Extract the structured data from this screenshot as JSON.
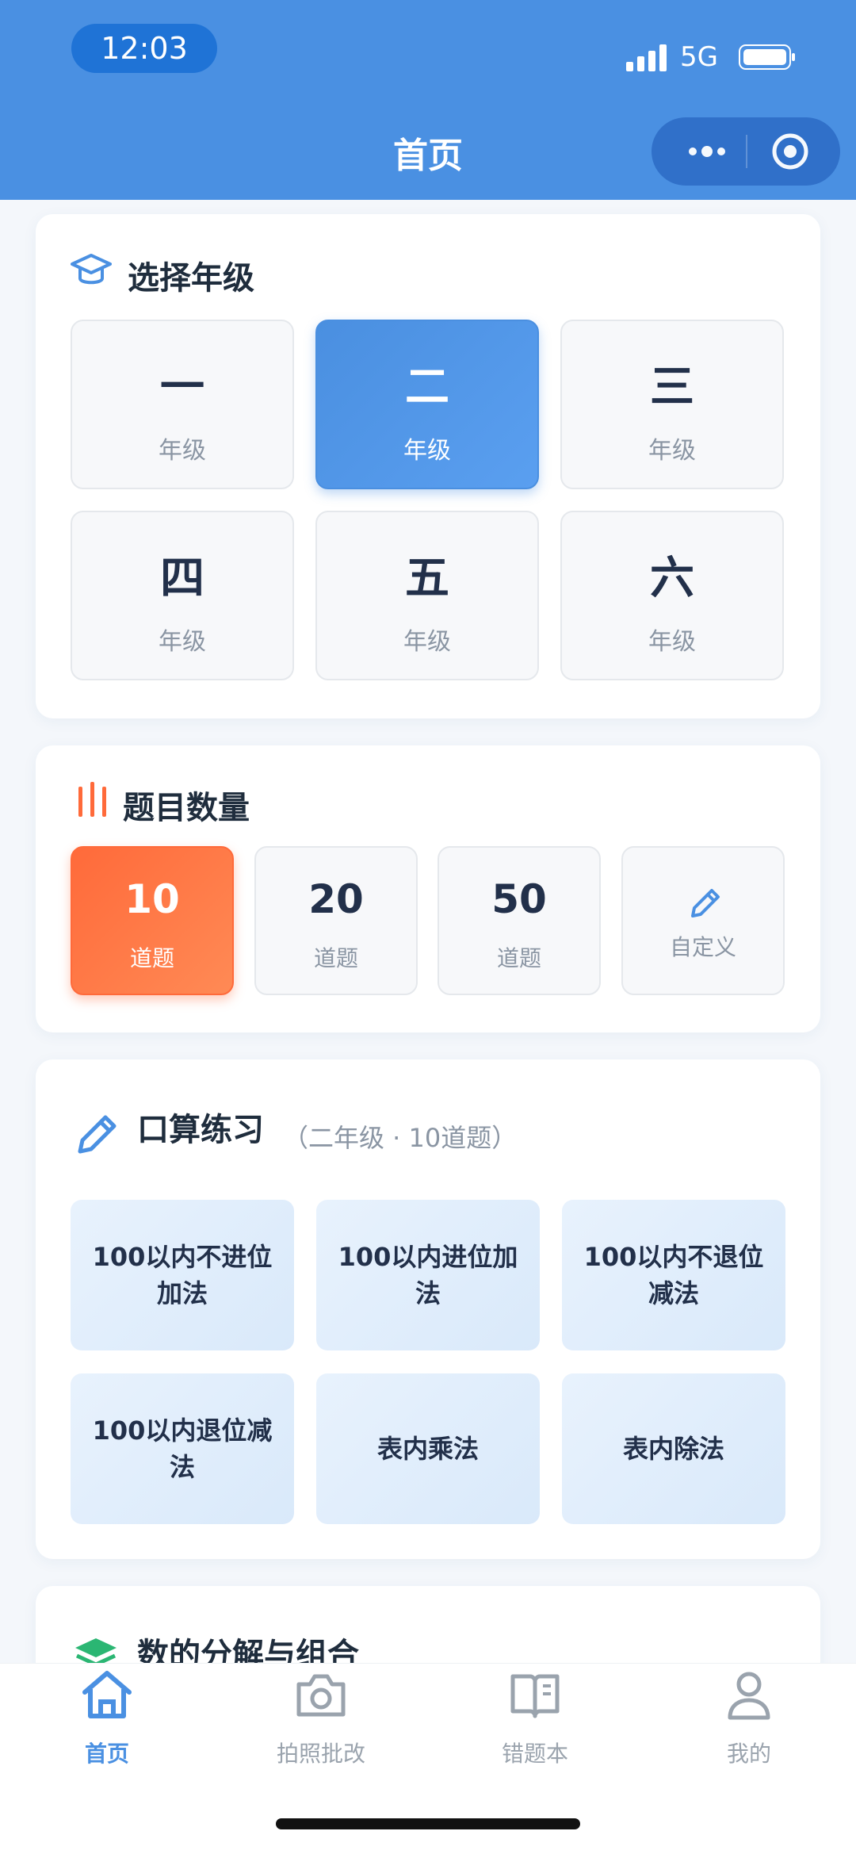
{
  "status": {
    "time": "12:03",
    "network": "5G"
  },
  "nav": {
    "title": "首页"
  },
  "grade_section": {
    "title": "选择年级",
    "selected": "二",
    "grades": [
      {
        "num": "一",
        "label": "年级"
      },
      {
        "num": "二",
        "label": "年级"
      },
      {
        "num": "三",
        "label": "年级"
      },
      {
        "num": "四",
        "label": "年级"
      },
      {
        "num": "五",
        "label": "年级"
      },
      {
        "num": "六",
        "label": "年级"
      }
    ]
  },
  "count_section": {
    "title": "题目数量",
    "selected": "10",
    "options": [
      {
        "num": "10",
        "label": "道题"
      },
      {
        "num": "20",
        "label": "道题"
      },
      {
        "num": "50",
        "label": "道题"
      }
    ],
    "custom_label": "自定义"
  },
  "practice_section": {
    "title": "口算练习",
    "subtitle": "（二年级 · 10道题）",
    "items": [
      "100以内不进位加法",
      "100以内进位加法",
      "100以内不退位减法",
      "100以内退位减法",
      "表内乘法",
      "表内除法"
    ]
  },
  "decompose_section": {
    "title": "数的分解与组合"
  },
  "tabs": [
    {
      "label": "首页",
      "icon": "home-icon",
      "active": true
    },
    {
      "label": "拍照批改",
      "icon": "camera-icon",
      "active": false
    },
    {
      "label": "错题本",
      "icon": "book-icon",
      "active": false
    },
    {
      "label": "我的",
      "icon": "user-icon",
      "active": false
    }
  ],
  "colors": {
    "primary": "#4a90e2",
    "accent": "#ff6a3a",
    "green": "#2bb673"
  }
}
